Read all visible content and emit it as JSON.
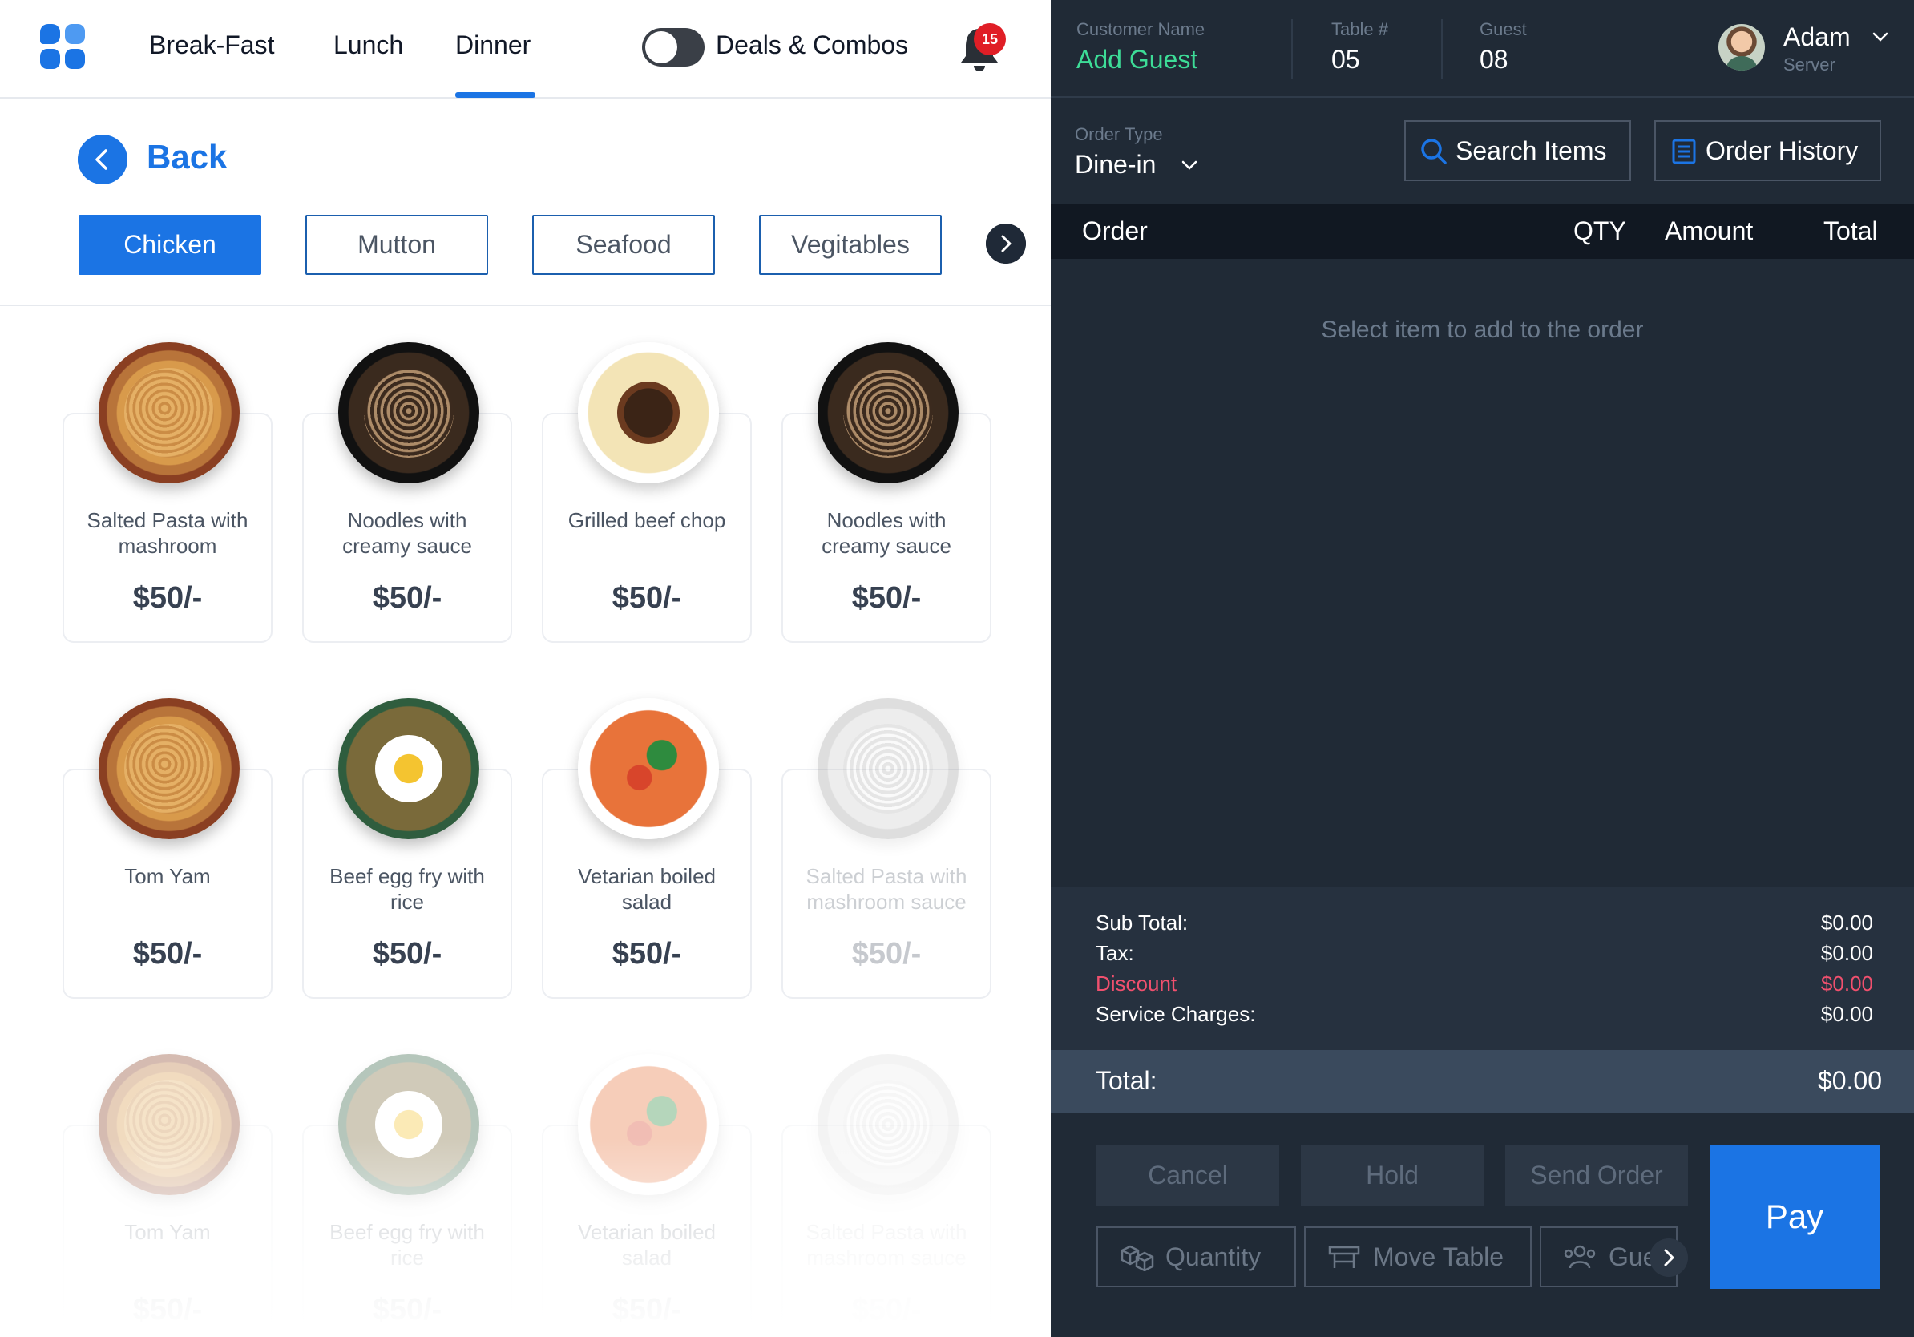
{
  "nav": {
    "tabs": [
      "Break-Fast",
      "Lunch",
      "Dinner"
    ],
    "active_tab": "Dinner",
    "deals_label": "Deals & Combos",
    "notification_count": "15"
  },
  "back_label": "Back",
  "categories": [
    "Chicken",
    "Mutton",
    "Seafood",
    "Vegitables"
  ],
  "active_category": "Chicken",
  "menu_items": [
    {
      "name": "Salted Pasta with mashroom",
      "price": "$50/-",
      "image": "pasta"
    },
    {
      "name": "Noodles with creamy sauce",
      "price": "$50/-",
      "image": "noodle"
    },
    {
      "name": "Grilled beef chop",
      "price": "$50/-",
      "image": "soup"
    },
    {
      "name": "Noodles with creamy sauce",
      "price": "$50/-",
      "image": "noodle"
    },
    {
      "name": "Tom Yam",
      "price": "$50/-",
      "image": "pasta"
    },
    {
      "name": "Beef egg fry with rice",
      "price": "$50/-",
      "image": "rice"
    },
    {
      "name": "Vetarian boiled salad",
      "price": "$50/-",
      "image": "salad"
    },
    {
      "name": "Salted Pasta with mashroom sauce",
      "price": "$50/-",
      "image": "grey",
      "disabled": true
    },
    {
      "name": "Tom Yam",
      "price": "$50/-",
      "image": "pasta"
    },
    {
      "name": "Beef egg fry with rice",
      "price": "$50/-",
      "image": "rice"
    },
    {
      "name": "Vetarian boiled salad",
      "price": "$50/-",
      "image": "salad"
    },
    {
      "name": "Salted Pasta with mashroom sauce",
      "price": "$50/-",
      "image": "grey",
      "disabled": true
    }
  ],
  "order_header": {
    "customer_label": "Customer Name",
    "customer_value": "Add Guest",
    "table_label": "Table #",
    "table_value": "05",
    "guest_label": "Guest",
    "guest_value": "08",
    "user_name": "Adam",
    "user_role": "Server"
  },
  "order_type": {
    "label": "Order Type",
    "value": "Dine-in"
  },
  "buttons": {
    "search": "Search Items",
    "history": "Order History"
  },
  "table_columns": [
    "Order",
    "QTY",
    "Amount",
    "Total"
  ],
  "empty_message": "Select item to add to the order",
  "summary": {
    "subtotal_label": "Sub Total:",
    "subtotal": "$0.00",
    "tax_label": "Tax:",
    "tax": "$0.00",
    "discount_label": "Discount",
    "discount": "$0.00",
    "service_label": "Service Charges:",
    "service": "$0.00",
    "total_label": "Total:",
    "total": "$0.00"
  },
  "actions": {
    "cancel": "Cancel",
    "hold": "Hold",
    "send": "Send Order",
    "quantity": "Quantity",
    "move_table": "Move Table",
    "guest": "Guest",
    "pay": "Pay"
  },
  "colors": {
    "accent": "#1b74e4",
    "panel_dark": "#202a36",
    "discount": "#f0506e",
    "guest_green": "#3ddc97",
    "badge": "#e01e26"
  }
}
